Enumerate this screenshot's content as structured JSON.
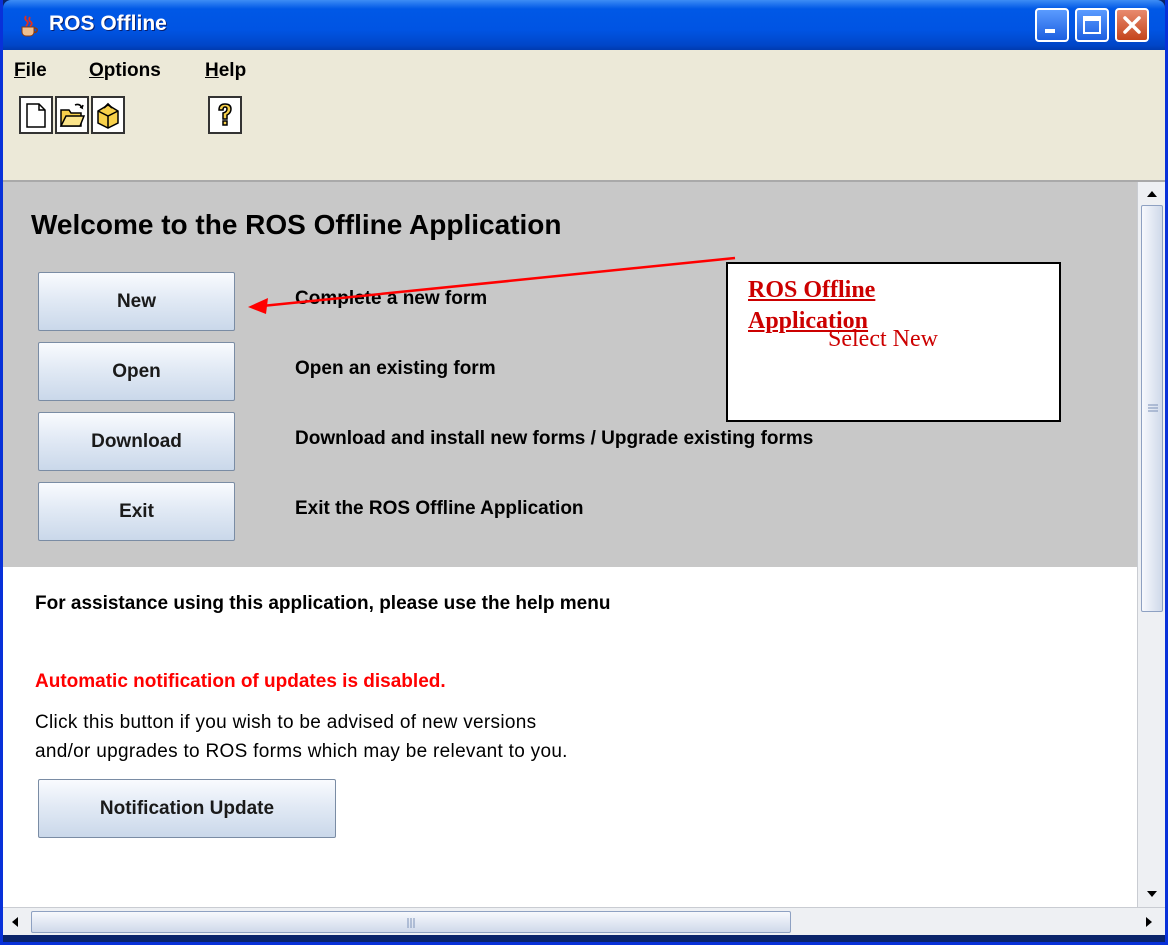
{
  "window": {
    "title": "ROS Offline"
  },
  "menu": {
    "file": "File",
    "file_mnemonic": "F",
    "options": "Options",
    "options_mnemonic": "O",
    "help": "Help",
    "help_mnemonic": "H"
  },
  "welcome": {
    "title": "Welcome to the ROS Offline Application",
    "actions": [
      {
        "label": "New",
        "description": "Complete a new form"
      },
      {
        "label": "Open",
        "description": "Open an existing form"
      },
      {
        "label": "Download",
        "description": "Download and install new forms / Upgrade existing forms"
      },
      {
        "label": "Exit",
        "description": "Exit the ROS Offline Application"
      }
    ]
  },
  "assistance": "For assistance using this application, please use the help menu",
  "notification": {
    "warning": "Automatic notification of updates is disabled.",
    "line1": "Click this button if you wish to be advised of new versions",
    "line2": "and/or upgrades to ROS forms which may be relevant to you.",
    "button": "Notification Update"
  },
  "callout": {
    "title_line1": "ROS Offline",
    "title_line2": "Application",
    "subtitle": "Select New"
  },
  "colors": {
    "titlebar": "#0054e3",
    "warning": "#ff0000",
    "callout": "#cc0000",
    "panel": "#c8c8c8"
  }
}
